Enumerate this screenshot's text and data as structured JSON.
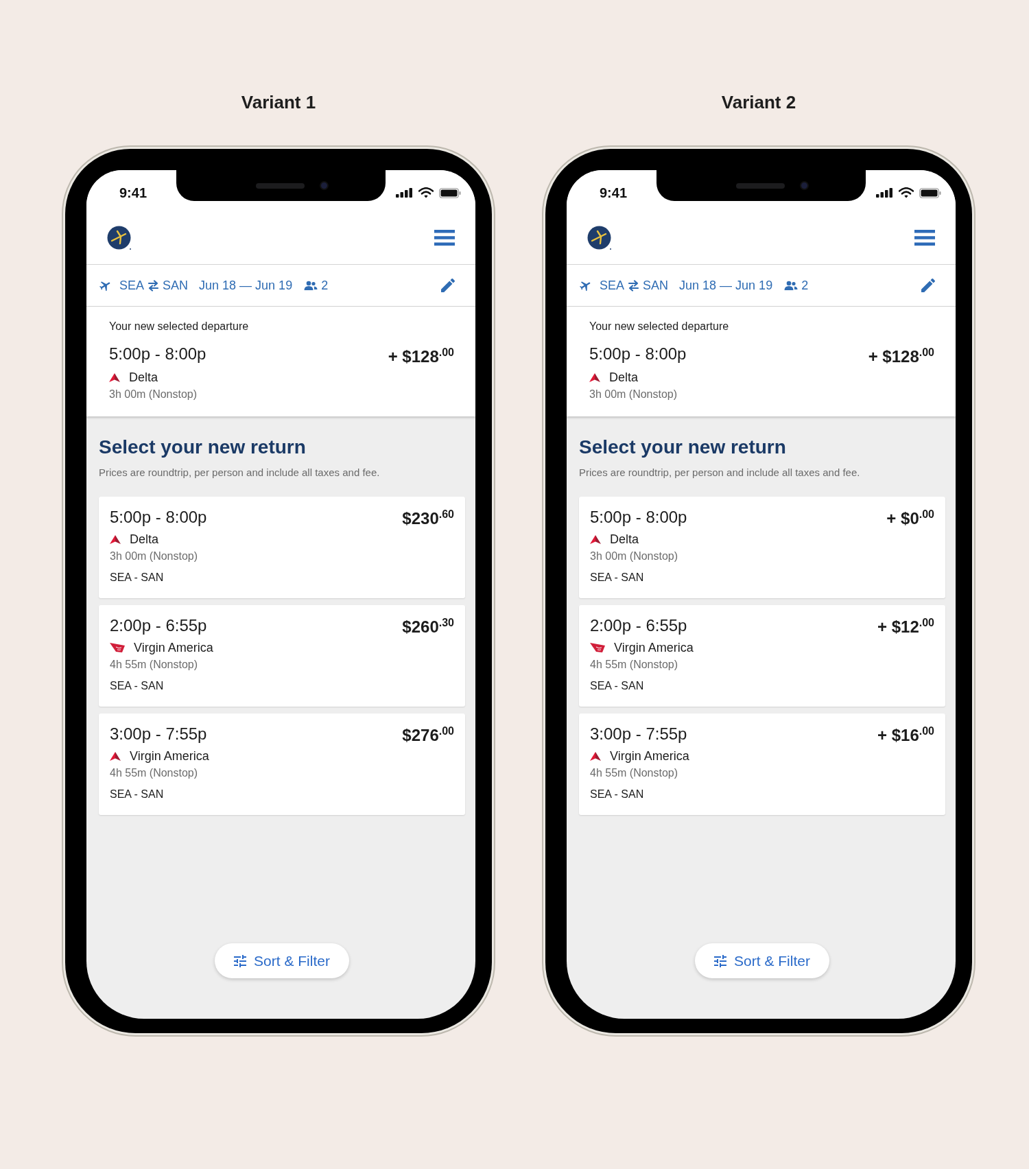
{
  "variants": [
    {
      "title": "Variant 1",
      "status_bar": {
        "time": "9:41"
      },
      "search_summary": {
        "origin": "SEA",
        "destination": "SAN",
        "dates": "Jun 18 — Jun 19",
        "travelers": "2"
      },
      "selected_departure": {
        "label": "Your new selected departure",
        "times": "5:00p - 8:00p",
        "kind": "triangle",
        "airline": "Delta",
        "duration": "3h 00m (Nonstop)",
        "price": "+ $128$^{.00}$"
      },
      "section": {
        "title": "Select your new return",
        "note": "Prices are roundtrip, per person and include all taxes and fee."
      },
      "flights": [
        {
          "times": "5:00p - 8:00p",
          "kind": "triangle",
          "airline": "Delta",
          "duration": "3h 00m (Nonstop)",
          "route": "SEA - SAN",
          "price": "$230$^{.60}$"
        },
        {
          "times": "2:00p - 6:55p",
          "kind": "wing",
          "airline": "Virgin America",
          "duration": "4h 55m (Nonstop)",
          "route": "SEA - SAN",
          "price": "$260$^{.30}$"
        },
        {
          "times": "3:00p - 7:55p",
          "kind": "triangle",
          "airline": "Virgin America",
          "duration": "4h 55m (Nonstop)",
          "route": "SEA - SAN",
          "price": "$276$^{.00}$"
        }
      ],
      "sort_filter_button": {
        "label": "Sort & Filter"
      }
    },
    {
      "title": "Variant 2",
      "status_bar": {
        "time": "9:41"
      },
      "search_summary": {
        "origin": "SEA",
        "destination": "SAN",
        "dates": "Jun 18 — Jun 19",
        "travelers": "2"
      },
      "selected_departure": {
        "label": "Your new selected departure",
        "times": "5:00p - 8:00p",
        "kind": "triangle",
        "airline": "Delta",
        "duration": "3h 00m (Nonstop)",
        "price": "+ $128$^{.00}$"
      },
      "section": {
        "title": "Select your new return",
        "note": "Prices are roundtrip, per person and include all taxes and fee."
      },
      "flights": [
        {
          "times": "5:00p - 8:00p",
          "kind": "triangle",
          "airline": "Delta",
          "duration": "3h 00m (Nonstop)",
          "route": "SEA - SAN",
          "price": "+ $0$^{.00}$"
        },
        {
          "times": "2:00p - 6:55p",
          "kind": "wing",
          "airline": "Virgin America",
          "duration": "4h 55m (Nonstop)",
          "route": "SEA - SAN",
          "price": "+ $12$^{.00}$"
        },
        {
          "times": "3:00p - 7:55p",
          "kind": "triangle",
          "airline": "Virgin America",
          "duration": "4h 55m (Nonstop)",
          "route": "SEA - SAN",
          "price": "+ $16$^{.00}$"
        }
      ],
      "sort_filter_button": {
        "label": "Sort & Filter"
      }
    }
  ]
}
